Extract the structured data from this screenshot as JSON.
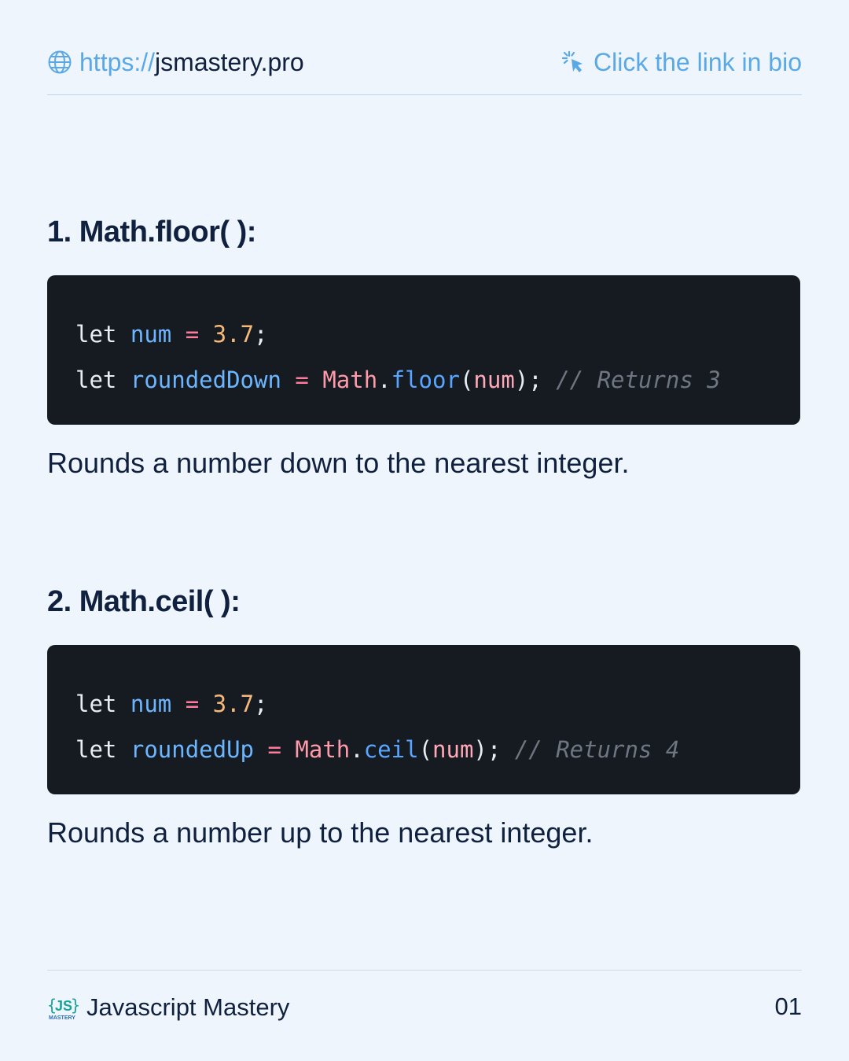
{
  "header": {
    "url_protocol": "https://",
    "url_domain": "jsmastery.pro",
    "cta": "Click the link in bio",
    "globe_icon": "globe-icon",
    "pointer_icon": "click-pointer-icon",
    "accent_color": "#5aa9e6"
  },
  "sections": [
    {
      "heading": "1. Math.floor( ):",
      "code": {
        "line1": {
          "kw": "let",
          "var": "num",
          "op": "=",
          "num": "3.7",
          "end": ";"
        },
        "line2": {
          "kw": "let",
          "var": "roundedDown",
          "op": "=",
          "obj": "Math",
          "dot": ".",
          "fn": "floor",
          "open": "(",
          "arg": "num",
          "close": ");",
          "comment": "// Returns 3"
        }
      },
      "description": "Rounds a number down to the nearest integer."
    },
    {
      "heading": "2. Math.ceil( ):",
      "code": {
        "line1": {
          "kw": "let",
          "var": "num",
          "op": "=",
          "num": "3.7",
          "end": ";"
        },
        "line2": {
          "kw": "let",
          "var": "roundedUp",
          "op": "=",
          "obj": "Math",
          "dot": ".",
          "fn": "ceil",
          "open": "(",
          "arg": "num",
          "close": ");",
          "comment": "// Returns 4"
        }
      },
      "description": "Rounds a number up to the nearest integer."
    }
  ],
  "footer": {
    "logo_text": "JS",
    "logo_subtext": "MASTERY",
    "brand": "Javascript Mastery",
    "page_number": "01"
  }
}
